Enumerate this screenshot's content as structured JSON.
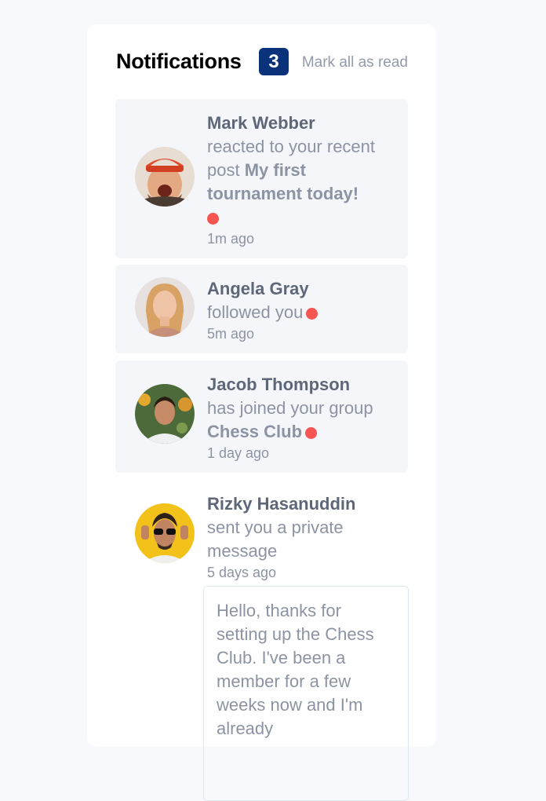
{
  "header": {
    "title": "Notifications",
    "unread_count": "3",
    "mark_all_label": "Mark all as read"
  },
  "notifications": [
    {
      "name": "Mark Webber",
      "action": "reacted to your recent post",
      "target": "My first tournament today!",
      "time": "1m ago",
      "unread": true
    },
    {
      "name": "Angela Gray",
      "action": "followed you",
      "target": "",
      "time": "5m ago",
      "unread": true
    },
    {
      "name": "Jacob Thompson",
      "action": "has joined your group",
      "target": "Chess Club",
      "time": "1 day ago",
      "unread": true
    },
    {
      "name": "Rizky Hasanuddin",
      "action": "sent you a private message",
      "target": "",
      "time": "5 days ago",
      "unread": false,
      "message": "Hello, thanks for setting up the Chess Club. I've been a member for a few weeks now and I'm already"
    }
  ],
  "colors": {
    "badge": "#0a327b",
    "unread_dot": "#f65552",
    "unread_bg": "#f5f6fa",
    "name_text": "#5e6778",
    "body_text": "#8c93a3"
  }
}
